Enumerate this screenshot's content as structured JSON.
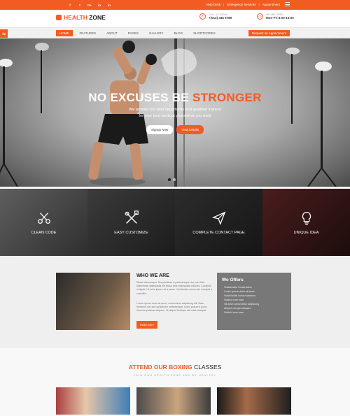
{
  "topbar": {
    "social": [
      "f",
      "t",
      "G+",
      "in",
      "in"
    ],
    "links": [
      "Help Desk",
      "Emergency Services",
      "Appointment"
    ]
  },
  "header": {
    "logo_part1": "HEALTH",
    "logo_part2": " ZONE",
    "call_label": "CALL US TODAY",
    "call_number": "+(012) 345 6789",
    "open_label": "WE ARE OPEN",
    "open_hours": "Mon-Fri 8:00-16:00"
  },
  "nav": {
    "items": [
      "HOME",
      "FEATURES",
      "ABOUT",
      "PAGES",
      "GALLERY",
      "BLOG",
      "SHORTCODES"
    ],
    "appointment": "Request an Appointment"
  },
  "hero": {
    "title_part1": "NO EXCUSES BE ",
    "title_part2": "STRONGER",
    "sub1": "We provide Our best opportunity and qualified trainers",
    "sub2": "for your best workout yourself as you want",
    "btn_signup": "Signup Now",
    "btn_details": "View Details"
  },
  "features": [
    "CLEAN CODE",
    "EASY CUSTOMIZE",
    "COMPLETE CONTACT PAGE",
    "UNIQUE IDEA"
  ],
  "about": {
    "title": "WHO WE ARE",
    "p1": "Etiam ullamcorper. Suspendisse a pellentesque dui, non felis. Maecenas malesuada elit lectus felis malesuada ultricies. Curabitur et ligula. Ut enim ipsum sit a purus. Vestibulum commodo volutpat a convallis.",
    "p2": "Lorem ipsum dolor sit amet, consectetur adipiscing elit. Nam hendrerit nisi sed sollicitudin pellentesque. Nunc posuere purus rhoncus pulvinar aliquam. Ut aliquet tristique nisl vitae volutpat.",
    "btn": "Read more",
    "offers_title": "We Offers",
    "offers": [
      "Sustainable Construction",
      "Lorem ipsum dolor sit amet",
      "Nulla facilisi luctus maximus",
      "Nulla id cum nam",
      "Sit amet consectetur adipiscing",
      "Aliquet nisi quis aliquam",
      "Nulla id cum nam"
    ]
  },
  "classes": {
    "title_orange": "ATTEND OUR BOXING",
    "title_dark": " CLASSES",
    "subtitle": "JOIN OUR HEALTH ZONE AND BE HEALTHY"
  }
}
